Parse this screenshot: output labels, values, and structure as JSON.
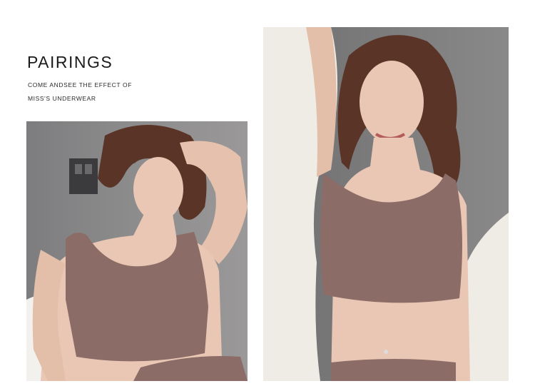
{
  "heading": "PAIRINGS",
  "subtitle_line1": "COME ANDSEE THE EFFECT OF",
  "subtitle_line2": "MISS'S UNDERWEAR",
  "colors": {
    "background": "#ffffff",
    "text": "#1b1b1b",
    "knit": "#8c6c66",
    "wall": "#7d7d7f",
    "robe": "#efece5",
    "hair": "#5a3527",
    "skin": "#eac7b4"
  },
  "images": [
    {
      "name": "model-left-photo",
      "description_icon": "photo-icon"
    },
    {
      "name": "model-right-photo",
      "description_icon": "photo-icon"
    }
  ]
}
